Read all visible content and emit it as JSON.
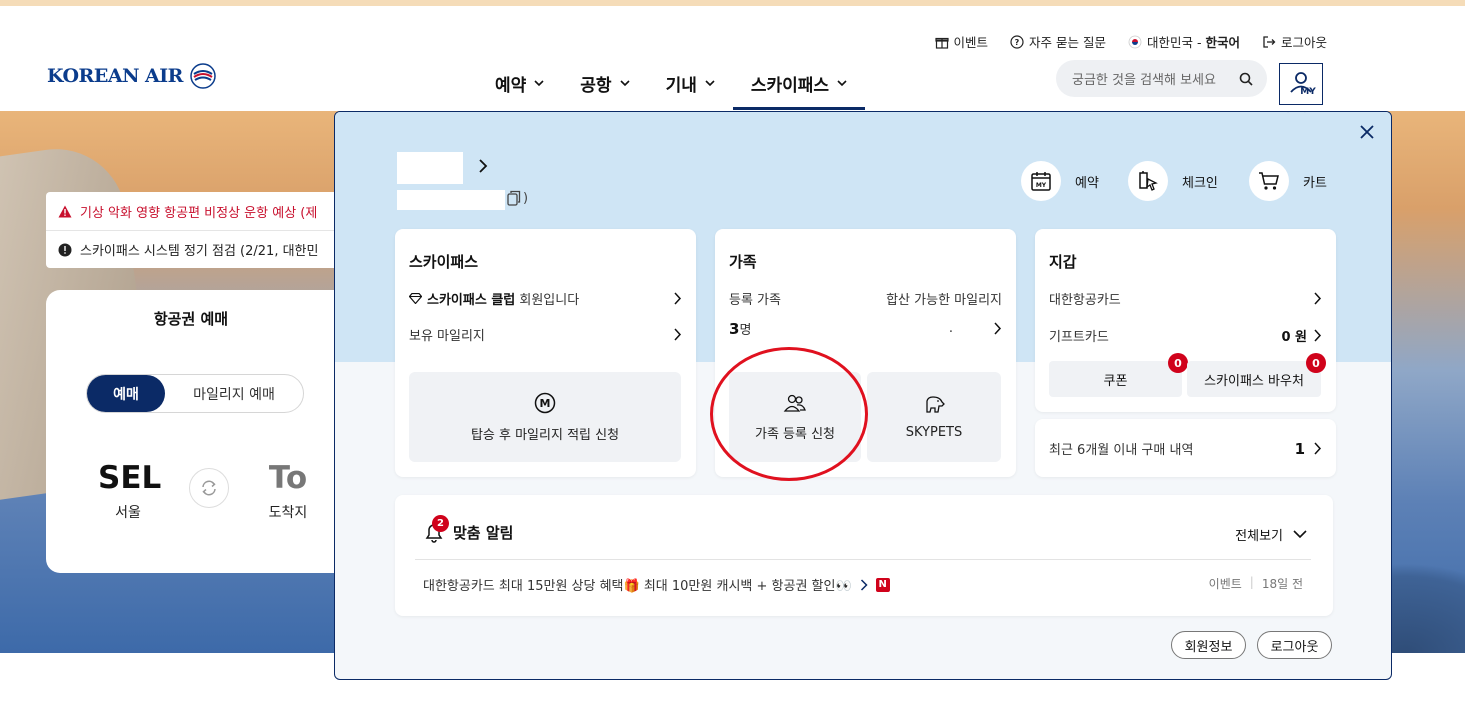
{
  "header": {
    "logo_text": "KOREAN AIR",
    "util": {
      "event": "이벤트",
      "faq": "자주 묻는 질문",
      "region": "대한민국 - ",
      "language": "한국어",
      "logout": "로그아웃"
    },
    "nav": [
      {
        "label": "예약"
      },
      {
        "label": "공항"
      },
      {
        "label": "기내"
      },
      {
        "label": "스카이패스"
      }
    ],
    "search_placeholder": "궁금한 것을 검색해 보세요",
    "my_label": "MY"
  },
  "notices": [
    {
      "text": "기상 악화 영향 항공편 비정상 운항 예상 (제"
    },
    {
      "text": "스카이패스 시스템 정기 점검 (2/21, 대한민"
    }
  ],
  "booking": {
    "title": "항공권 예매",
    "tab_active": "예매",
    "tab_other": "마일리지 예매",
    "from_code": "SEL",
    "from_city": "서울",
    "to_code": "To",
    "to_city": "도착지"
  },
  "panel": {
    "copy_suffix": ")",
    "quick": [
      {
        "label": "예약",
        "icon": "calendar-my-icon"
      },
      {
        "label": "체크인",
        "icon": "checkin-icon"
      },
      {
        "label": "카트",
        "icon": "cart-icon"
      }
    ],
    "skypass": {
      "title": "스카이패스",
      "club_name": "스카이패스 클럽",
      "club_suffix": " 회원입니다",
      "mileage_label": "보유 마일리지",
      "tile_label": "탑승 후 마일리지 적립 신청"
    },
    "family": {
      "title": "가족",
      "registered_label": "등록 가족",
      "combinable_label": "합산 가능한 마일리지",
      "count_num": "3",
      "count_unit": "명",
      "combinable_value": ".",
      "tile1_label": "가족 등록 신청",
      "tile2_label": "SKYPETS"
    },
    "wallet": {
      "title": "지갑",
      "card_label": "대한항공카드",
      "gift_label": "기프트카드",
      "gift_value": "0 원",
      "coupon_label": "쿠폰",
      "coupon_count": "0",
      "voucher_label": "스카이패스 바우처",
      "voucher_count": "0"
    },
    "purchase": {
      "label": "최근 6개월 이내 구매 내역",
      "count": "1"
    },
    "alerts": {
      "title": "맞춤 알림",
      "badge": "2",
      "view_all": "전체보기",
      "item_text_a": "대한항공카드 최대 15만원 상당 혜택",
      "item_text_b": " 최대 10만원 캐시백 + 항공권 할인",
      "item_new": "N",
      "item_category": "이벤트",
      "item_time": "18일 전"
    },
    "btn_member_info": "회원정보",
    "btn_logout": "로그아웃"
  },
  "colors": {
    "brand_navy": "#0b2a66",
    "alert_red": "#c8102e",
    "badge_red": "#d0021b",
    "panel_top": "#cfe5f5"
  }
}
